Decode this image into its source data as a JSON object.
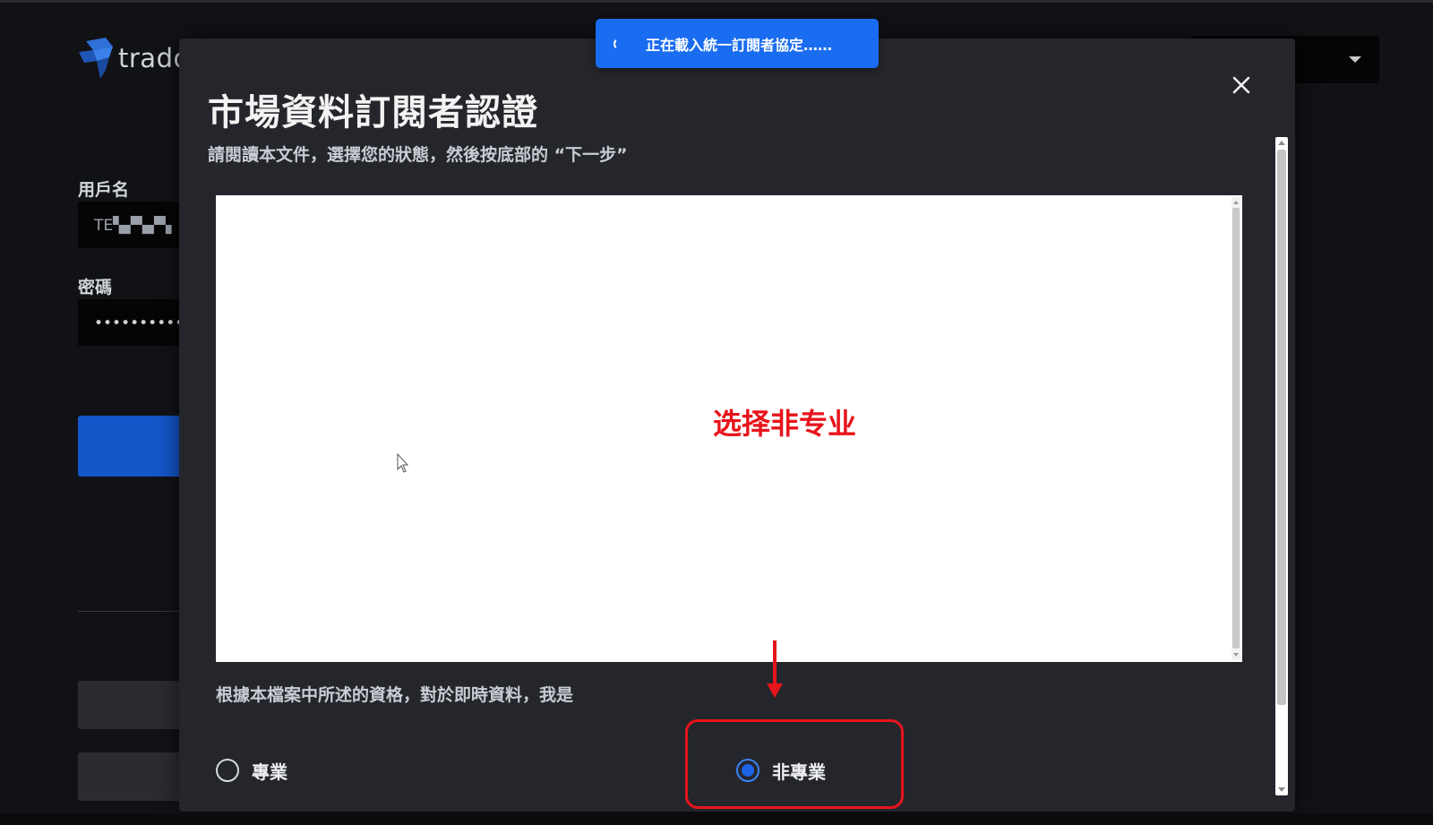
{
  "background": {
    "logo_text": "trado",
    "username_label": "用戶名",
    "username_value": "TE▚▞▚▞▚",
    "password_label": "密碼",
    "password_value": "••••••••••••••"
  },
  "toast": {
    "message": "正在載入統一訂閱者協定……"
  },
  "dialog": {
    "title": "市場資料訂閱者認證",
    "subtitle": "請閱讀本文件，選擇您的狀態，然後按底部的 “下一步”",
    "qualification_text": "根據本檔案中所述的資格，對於即時資料，我是",
    "options": [
      {
        "label": "專業",
        "checked": false
      },
      {
        "label": "非專業",
        "checked": true
      }
    ]
  },
  "annotation": {
    "text": "选择非专业",
    "color": "#e8141b"
  },
  "colors": {
    "accent": "#1a6cf0",
    "annotation": "#e8141b",
    "dialog_bg": "#24262c"
  }
}
